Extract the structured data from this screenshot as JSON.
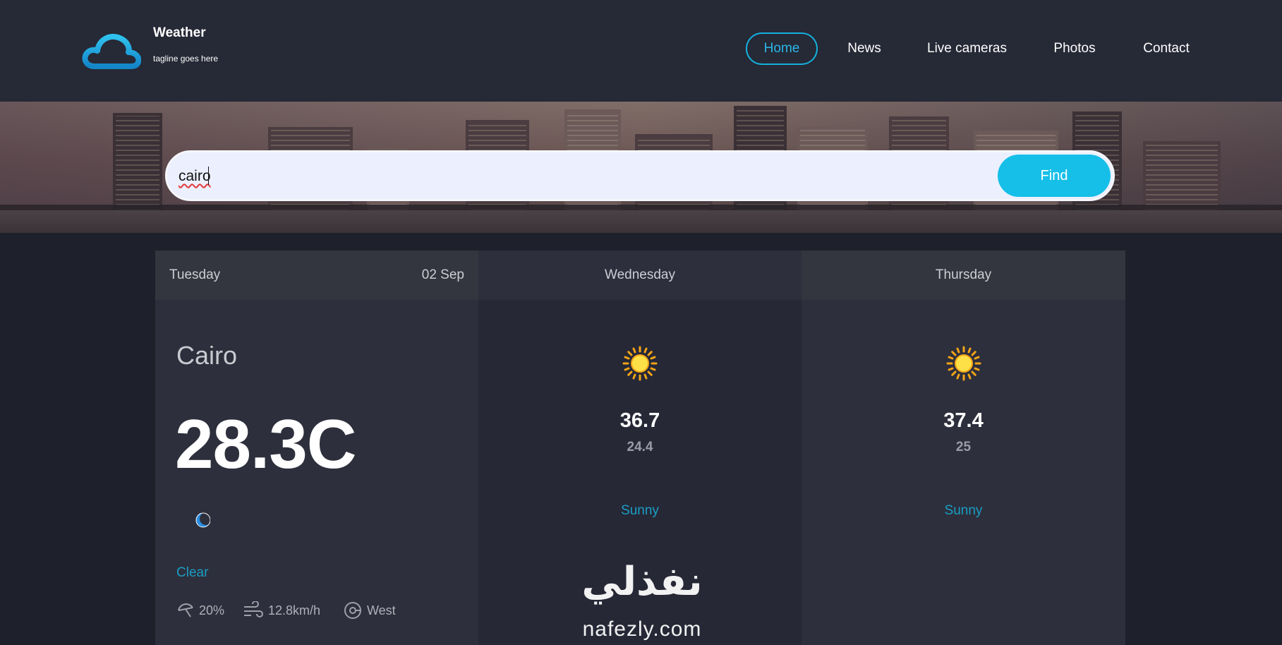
{
  "header": {
    "brand_title": "Weather",
    "tagline": "tagline goes here",
    "nav": [
      {
        "label": "Home",
        "active": true
      },
      {
        "label": "News",
        "active": false
      },
      {
        "label": "Live cameras",
        "active": false
      },
      {
        "label": "Photos",
        "active": false
      },
      {
        "label": "Contact",
        "active": false
      }
    ]
  },
  "search": {
    "value": "cairo",
    "button_label": "Find"
  },
  "today": {
    "day": "Tuesday",
    "date": "02 Sep",
    "city": "Cairo",
    "temperature": "28.3C",
    "icon": "moon-icon",
    "condition": "Clear",
    "humidity": "20%",
    "wind_speed": "12.8km/h",
    "wind_direction": "West"
  },
  "forecast": [
    {
      "day": "Wednesday",
      "icon": "sun-icon",
      "high": "36.7",
      "low": "24.4",
      "condition": "Sunny"
    },
    {
      "day": "Thursday",
      "icon": "sun-icon",
      "high": "37.4",
      "low": "25",
      "condition": "Sunny"
    }
  ],
  "watermark": {
    "arabic": "نفذلي",
    "latin": "nafezly.com"
  },
  "colors": {
    "accent": "#16bfe8",
    "background": "#1e202b",
    "header": "#262936",
    "condition_text": "#1a9ec4"
  }
}
